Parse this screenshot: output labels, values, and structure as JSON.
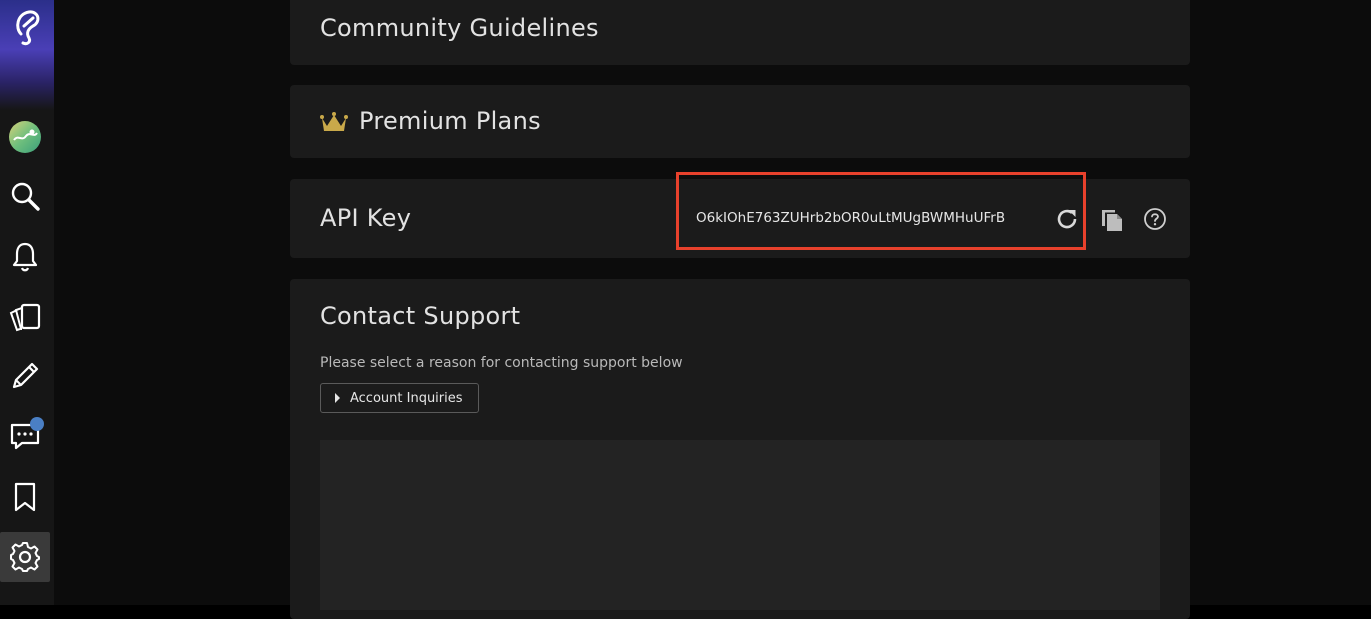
{
  "sections": {
    "community": {
      "title": "Community Guidelines"
    },
    "premium": {
      "title": "Premium Plans"
    },
    "api": {
      "title": "API Key",
      "key_value": "O6kIOhE763ZUHrb2bOR0uLtMUgBWMHuUFrB"
    },
    "support": {
      "title": "Contact Support",
      "prompt": "Please select a reason for contacting support below",
      "reason_dropdown": "Account Inquiries"
    }
  },
  "sidebar": {
    "items": [
      "logo-icon",
      "profile-avatar",
      "search-icon",
      "bell-icon",
      "cards-icon",
      "pencil-icon",
      "chat-icon",
      "bookmark-icon",
      "gear-icon"
    ],
    "active": "gear-icon"
  },
  "colors": {
    "highlight": "#e8412c",
    "crown": "#c9a94a",
    "badge": "#4a7fc4"
  }
}
